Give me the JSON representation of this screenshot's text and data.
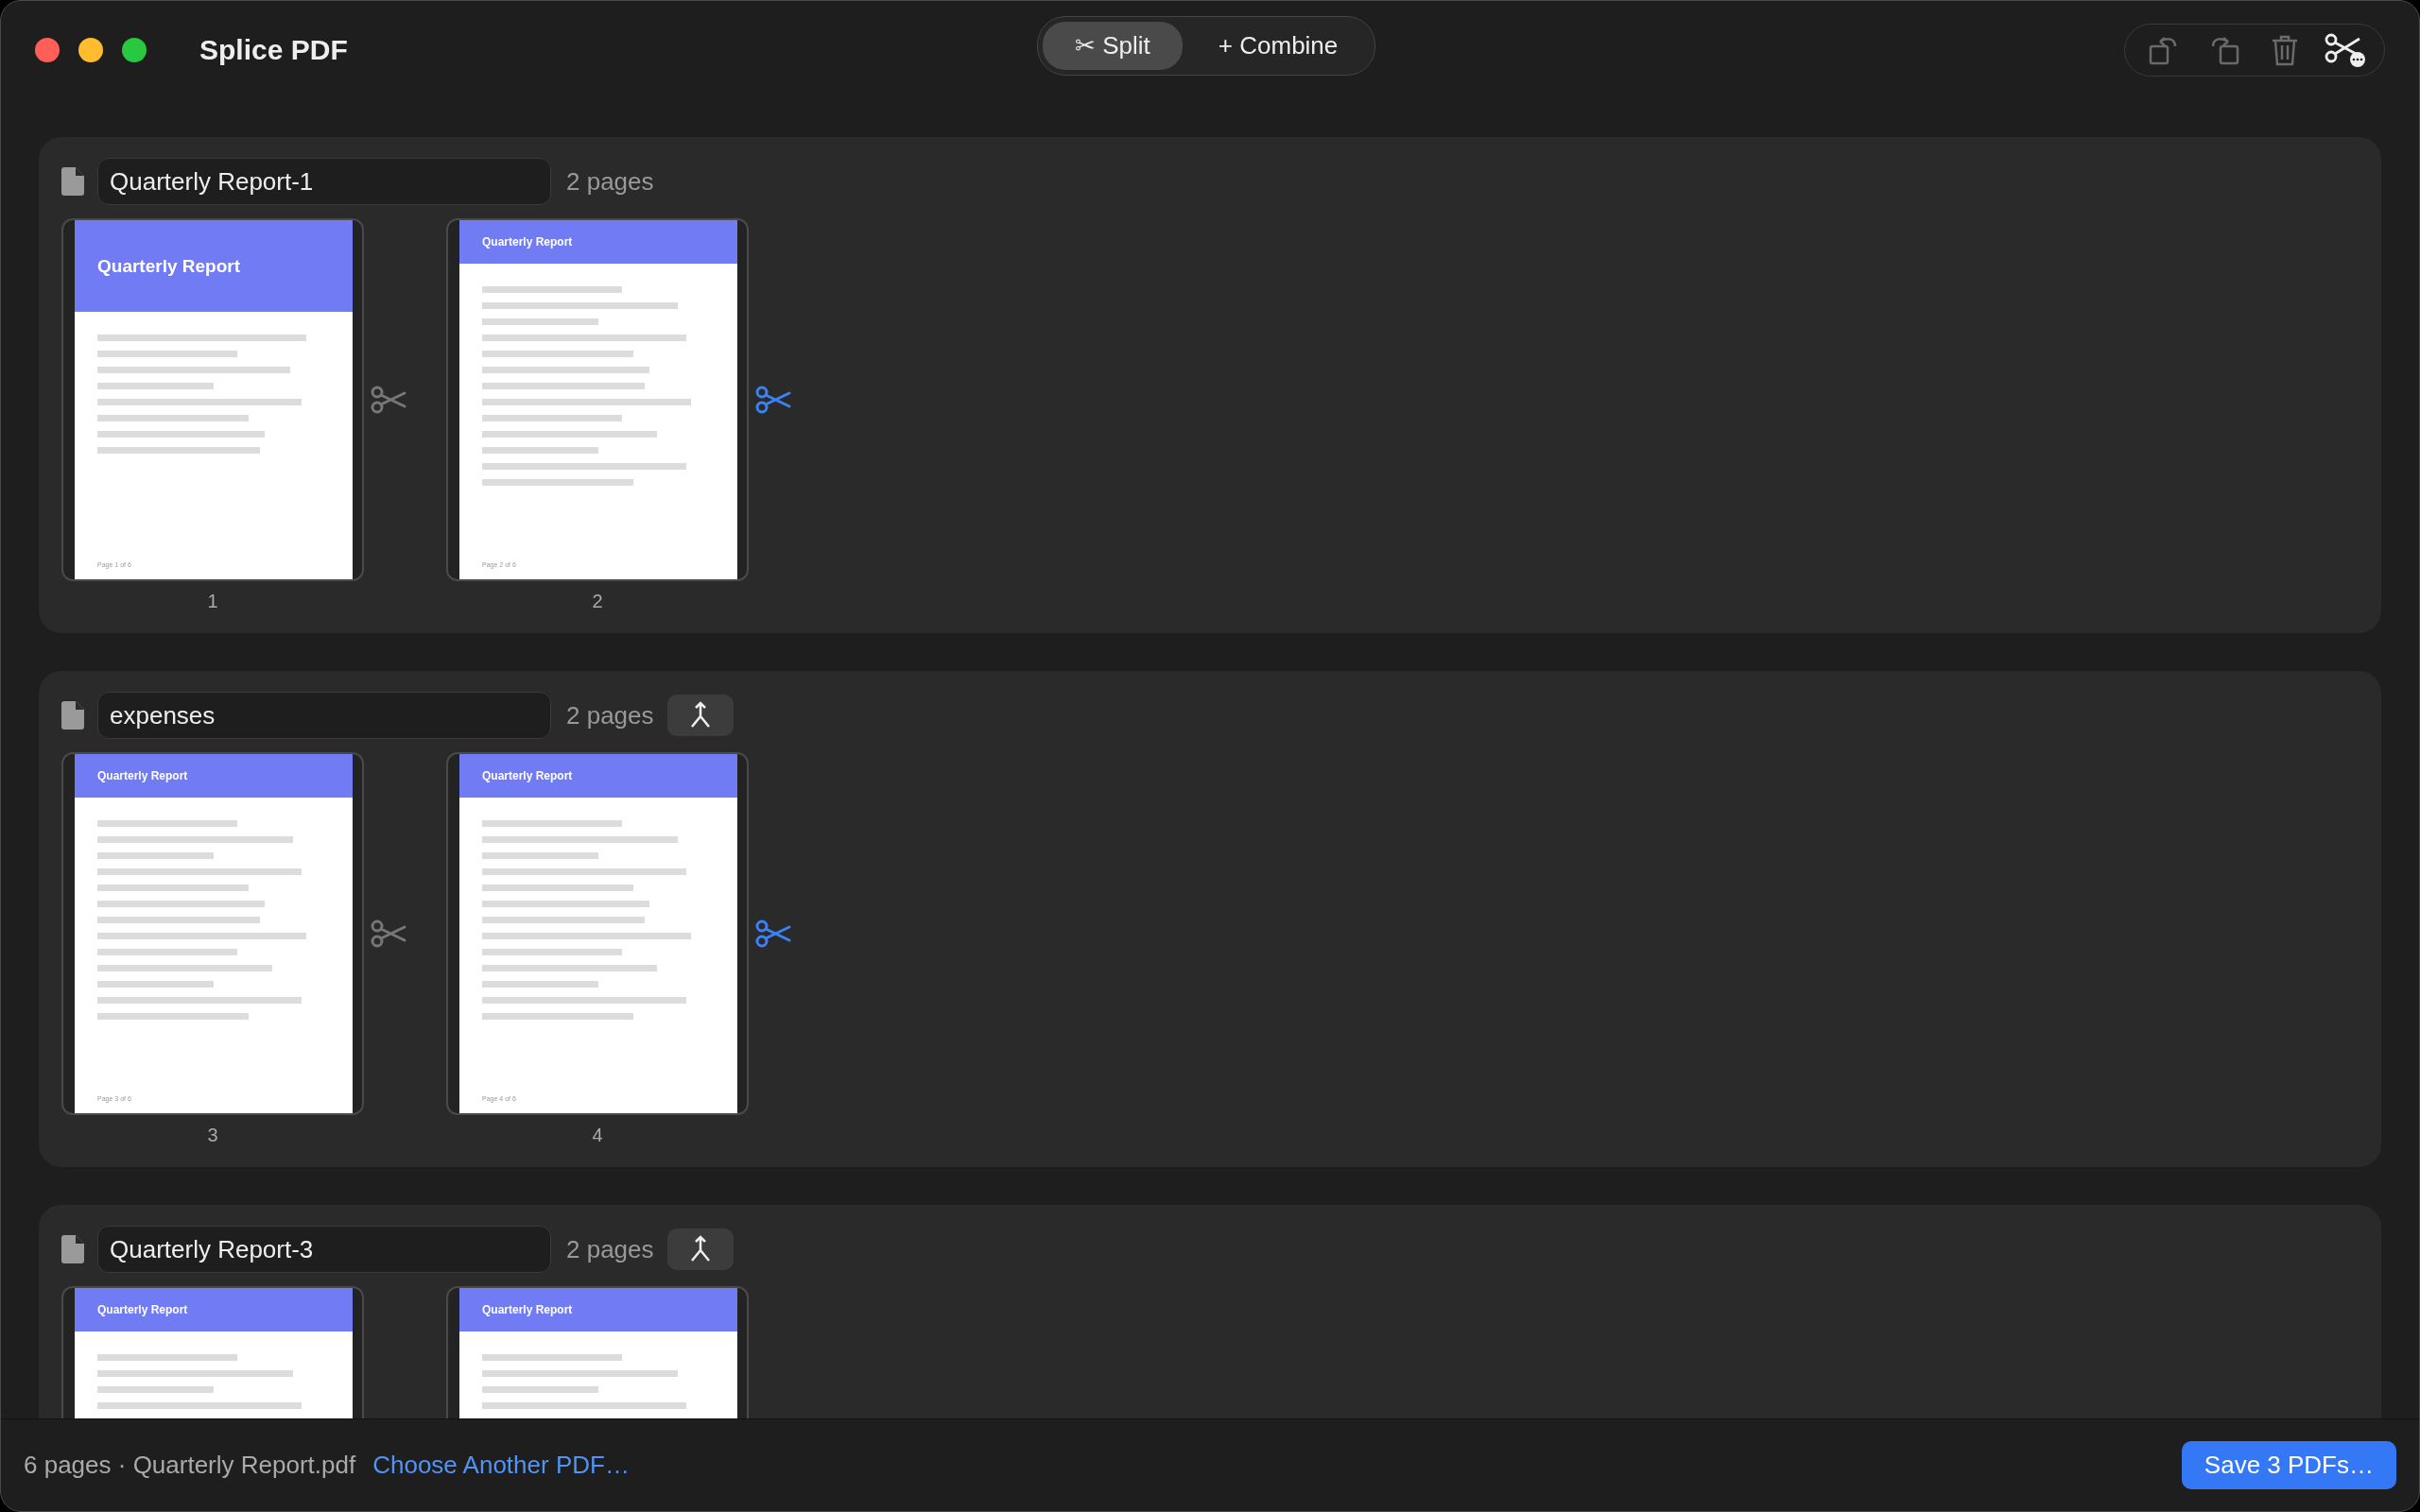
{
  "window": {
    "title": "Splice PDF"
  },
  "mode_tabs": [
    {
      "icon": "✂",
      "label": "Split",
      "selected": true
    },
    {
      "icon": "+",
      "label": "Combine",
      "selected": false
    }
  ],
  "toolbar": [
    {
      "kind": "rotate-left",
      "disabled": true
    },
    {
      "kind": "rotate-right",
      "disabled": true
    },
    {
      "kind": "trash",
      "disabled": true
    },
    {
      "kind": "split-more",
      "disabled": false
    }
  ],
  "groups": [
    {
      "name": "Quarterly Report-1",
      "count": "2 pages",
      "merge_button": false,
      "pages": [
        {
          "kind": "title",
          "heading": "Quarterly Report",
          "footer": "Page 1 of 6",
          "number": "1",
          "split": false
        },
        {
          "kind": "body",
          "heading": "Quarterly Report",
          "footer": "Page 2 of 6",
          "number": "2",
          "split": true
        }
      ]
    },
    {
      "name": "expenses",
      "count": "2 pages",
      "merge_button": true,
      "pages": [
        {
          "kind": "body",
          "heading": "Quarterly Report",
          "footer": "Page 3 of 6",
          "number": "3",
          "split": false
        },
        {
          "kind": "body",
          "heading": "Quarterly Report",
          "footer": "Page 4 of 6",
          "number": "4",
          "split": true
        }
      ]
    },
    {
      "name": "Quarterly Report-3",
      "count": "2 pages",
      "merge_button": true,
      "pages": [
        {
          "kind": "body",
          "heading": "Quarterly Report"
        },
        {
          "kind": "body",
          "heading": "Quarterly Report"
        }
      ]
    }
  ],
  "status_bar": {
    "summary": "6 pages · Quarterly Report.pdf",
    "link": "Choose Another PDF…",
    "save_button": "Save 3 PDFs…"
  }
}
